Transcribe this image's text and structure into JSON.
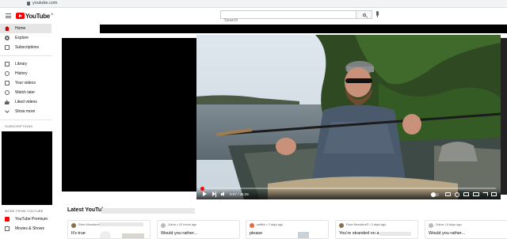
{
  "browser": {
    "url": "youtube.com"
  },
  "masthead": {
    "logo_text": "YouTube",
    "logo_suffix": "IN",
    "search_placeholder": "Search"
  },
  "sidebar": {
    "items": [
      {
        "label": "Home",
        "icon": "home-icon",
        "active": true
      },
      {
        "label": "Explore",
        "icon": "compass-icon"
      },
      {
        "label": "Subscriptions",
        "icon": "subscriptions-icon"
      }
    ],
    "library_items": [
      {
        "label": "Library",
        "icon": "library-icon"
      },
      {
        "label": "History",
        "icon": "history-icon"
      },
      {
        "label": "Your videos",
        "icon": "your-videos-icon"
      },
      {
        "label": "Watch later",
        "icon": "clock-icon"
      },
      {
        "label": "Liked videos",
        "icon": "thumbs-up-icon"
      },
      {
        "label": "Show more",
        "icon": "chevron-down-icon"
      }
    ],
    "subscriptions_heading": "SUBSCRIPTIONS",
    "more_heading": "MORE FROM YOUTUBE",
    "more_items": [
      {
        "label": "YouTube Premium",
        "icon": "premium-icon"
      },
      {
        "label": "Movies & Shows",
        "icon": "movies-icon"
      }
    ]
  },
  "player": {
    "current_time": "0:07",
    "duration": "35:29",
    "time_display": "0:07 / 35:29",
    "progress_fraction": 0.003
  },
  "shelf": {
    "title": "Latest YouTube",
    "posts": [
      {
        "meta": "River Monsters® • 24 minutes ago",
        "text": "It's true"
      },
      {
        "meta": "Zolrac • 22 hours ago",
        "text": "Would you rather..."
      },
      {
        "meta": "waffee • 3 days ago",
        "text": "please"
      },
      {
        "meta": "River Monsters® • 3 days ago",
        "text": "You're stranded on a"
      },
      {
        "meta": "Zolrac • 5 days ago",
        "text": "Would you rather..."
      }
    ]
  },
  "colors": {
    "brand_red": "#ff0000",
    "active_bg": "#e5e5e5"
  }
}
